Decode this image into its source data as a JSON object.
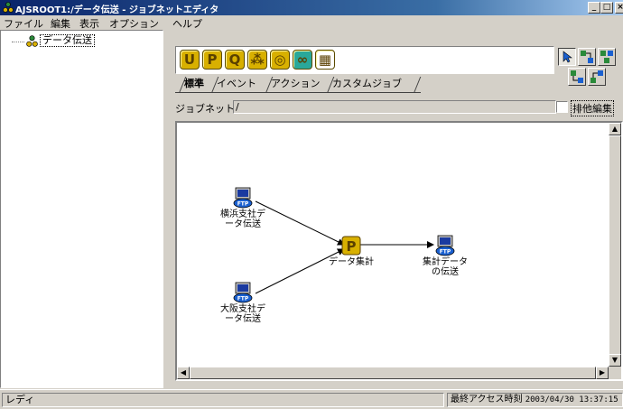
{
  "window": {
    "title": "AJSROOT1:/データ伝送 - ジョブネットエディタ",
    "min_label": "_",
    "max_label": "□",
    "close_label": "×"
  },
  "menu": {
    "items": [
      {
        "label": "ファイル"
      },
      {
        "label": "編集"
      },
      {
        "label": "表示"
      },
      {
        "label": "オプション"
      },
      {
        "label": "ヘルプ"
      }
    ]
  },
  "tree": {
    "root_label": "データ伝送"
  },
  "palette": {
    "icons": [
      {
        "name": "u-unit-icon",
        "glyph": "U",
        "color": "#d8b000"
      },
      {
        "name": "p-unit-icon",
        "glyph": "P",
        "color": "#d8b000"
      },
      {
        "name": "q-unit-icon",
        "glyph": "Q",
        "color": "#d8b000"
      },
      {
        "name": "jobnet-icon",
        "glyph": "⁂",
        "color": "#d8b000"
      },
      {
        "name": "remote-jobnet-icon",
        "glyph": "◎",
        "color": "#d8b000"
      },
      {
        "name": "link-icon",
        "glyph": "∞",
        "color": "#2aa89a"
      },
      {
        "name": "flag-icon",
        "glyph": "▦",
        "color": "#ffffff"
      }
    ]
  },
  "tabs": [
    {
      "label": "標準",
      "active": true
    },
    {
      "label": "イベント",
      "active": false
    },
    {
      "label": "アクション",
      "active": false
    },
    {
      "label": "カスタムジョブ",
      "active": false
    }
  ],
  "jobnet": {
    "label": "ジョブネット:",
    "value": "/",
    "exclusive_edit_label": "排他編集",
    "exclusive_edit_checked": false
  },
  "nodes": [
    {
      "id": "yokohama",
      "label": "横浜支社デ\nータ伝送",
      "type": "ftp"
    },
    {
      "id": "osaka",
      "label": "大阪支社デ\nータ伝送",
      "type": "ftp"
    },
    {
      "id": "aggregate",
      "label": "データ集計",
      "type": "p"
    },
    {
      "id": "send",
      "label": "集計データ\nの伝送",
      "type": "ftp"
    }
  ],
  "status": {
    "left": "レディ",
    "right_label": "最終アクセス時刻",
    "right_value": "2003/04/30 13:37:15"
  }
}
